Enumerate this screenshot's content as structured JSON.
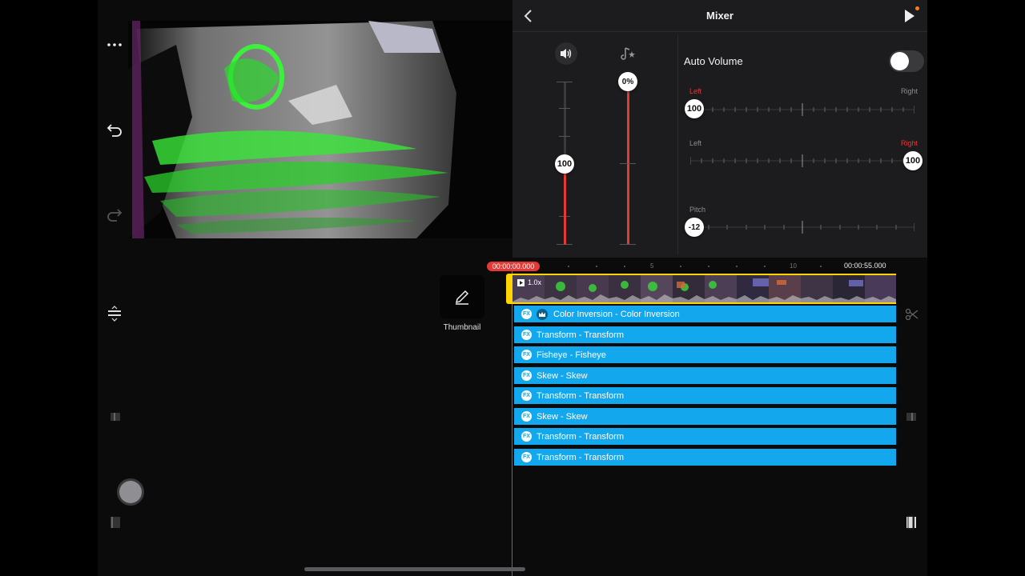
{
  "mixer": {
    "title": "Mixer",
    "icons": {
      "back": "chevron-left-icon",
      "play": "play-icon",
      "volume": "speaker-icon",
      "background_music": "music-star-icon"
    },
    "clip_volume": {
      "value_label": "100",
      "level_percent": 50
    },
    "bg_music_volume": {
      "value_label": "0%",
      "level_percent": 100
    },
    "auto_volume": {
      "label": "Auto Volume",
      "enabled": false
    },
    "pan_left": {
      "left_label": "Left",
      "right_label": "Right",
      "value_label": "100",
      "position_percent": 0
    },
    "pan_right": {
      "left_label": "Left",
      "right_label": "Right",
      "value_label": "100",
      "position_percent": 100
    },
    "pitch": {
      "label": "Pitch",
      "value_label": "-12",
      "position_percent": 0
    }
  },
  "rail": {
    "icons": [
      "more-icon",
      "undo-icon",
      "redo-icon",
      "layers-icon",
      "record-icon"
    ]
  },
  "timeline": {
    "current_time": "00:00:00.000",
    "end_time": "00:00:55.000",
    "ruler_marks": [
      "5",
      "10"
    ],
    "clip_speed": "1.0x",
    "thumbnail_label": "Thumbnail",
    "layers": [
      {
        "label": "Color Inversion - Color Inversion",
        "premium": true
      },
      {
        "label": "Transform - Transform",
        "premium": false
      },
      {
        "label": "Fisheye - Fisheye",
        "premium": false
      },
      {
        "label": "Skew - Skew",
        "premium": false
      },
      {
        "label": "Transform - Transform",
        "premium": false
      },
      {
        "label": "Skew - Skew",
        "premium": false
      },
      {
        "label": "Transform - Transform",
        "premium": false
      },
      {
        "label": "Transform - Transform",
        "premium": false
      }
    ],
    "fx_badge": "FX"
  },
  "colors": {
    "accent_red": "#e53935",
    "layer_blue": "#13a7ee",
    "clip_yellow": "#ffd400"
  }
}
